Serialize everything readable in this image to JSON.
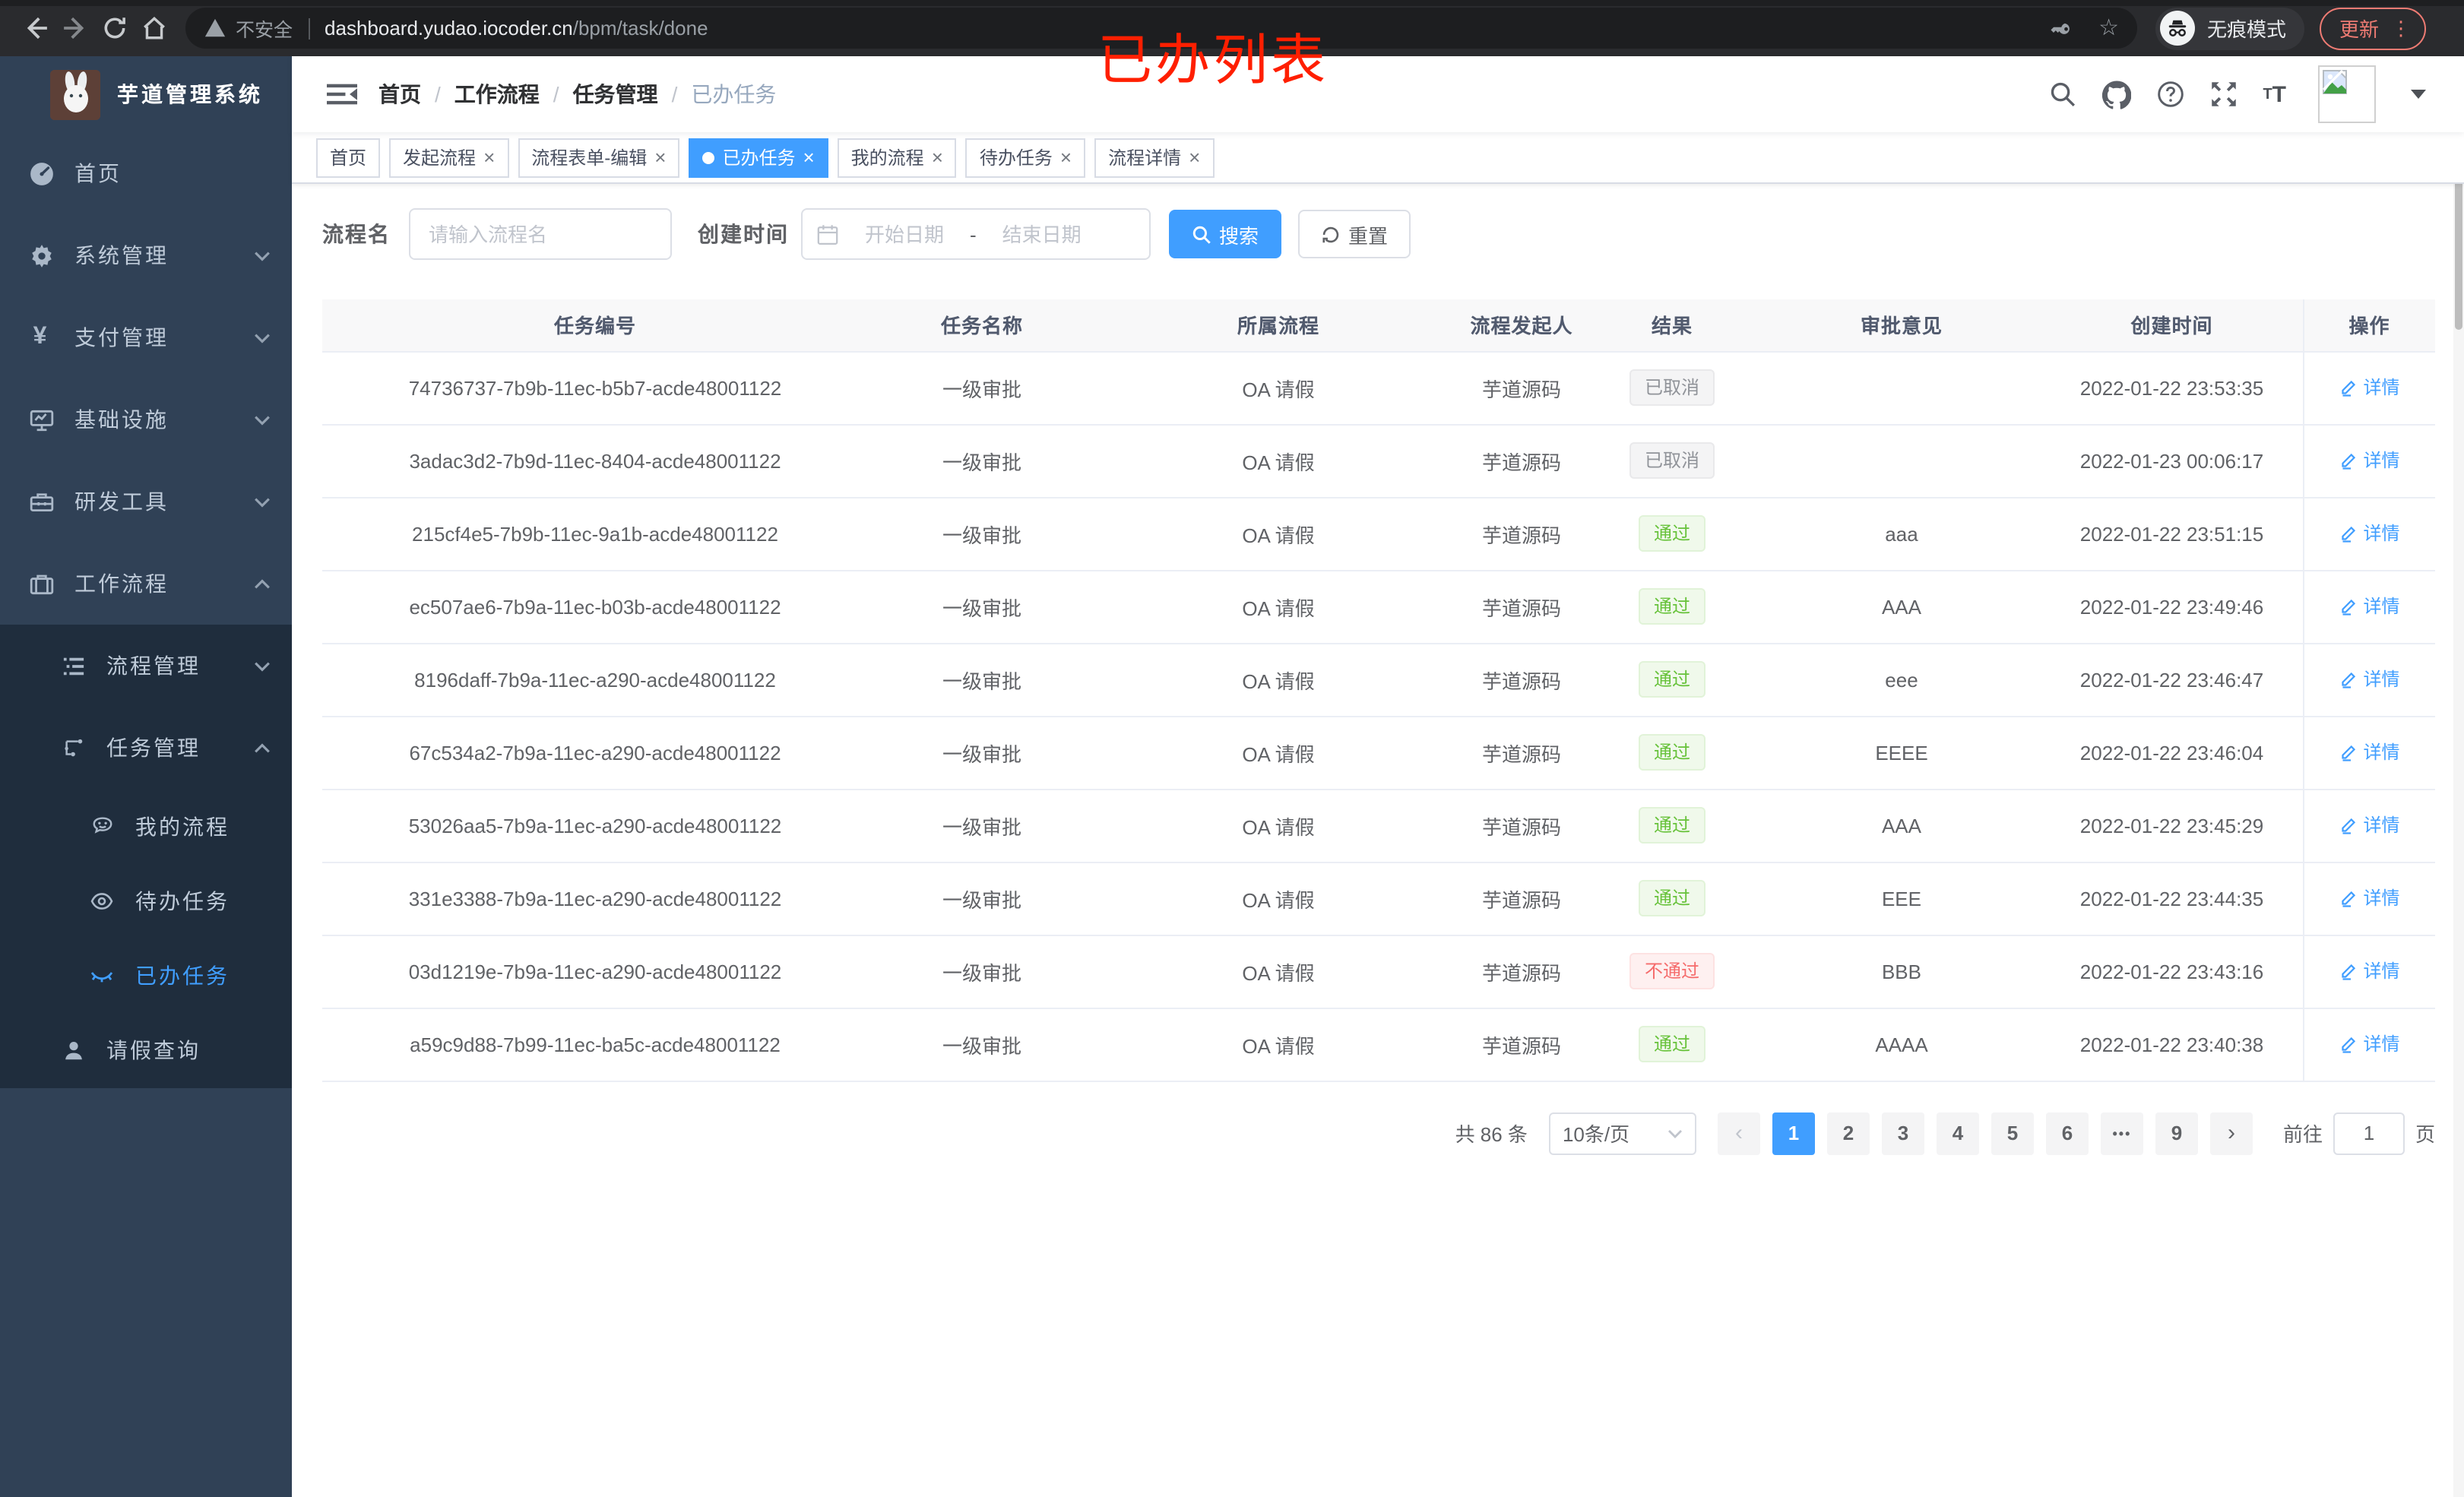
{
  "annotation": {
    "text": "已办列表",
    "color": "#ff1f00"
  },
  "browser": {
    "security_label": "不安全",
    "url_host": "dashboard.yudao.iocoder.cn",
    "url_path": "/bpm/task/done",
    "incognito_label": "无痕模式",
    "update_label": "更新"
  },
  "sidebar": {
    "app_title": "芋道管理系统",
    "menu": [
      {
        "label": "首页"
      },
      {
        "label": "系统管理"
      },
      {
        "label": "支付管理"
      },
      {
        "label": "基础设施"
      },
      {
        "label": "研发工具"
      },
      {
        "label": "工作流程"
      }
    ],
    "submenu": {
      "process_mgmt": "流程管理",
      "task_mgmt": "任务管理",
      "my_process": "我的流程",
      "todo_tasks": "待办任务",
      "done_tasks": "已办任务",
      "leave_query": "请假查询"
    }
  },
  "breadcrumb": [
    "首页",
    "工作流程",
    "任务管理",
    "已办任务"
  ],
  "tabs": [
    {
      "label": "首页"
    },
    {
      "label": "发起流程"
    },
    {
      "label": "流程表单-编辑"
    },
    {
      "label": "已办任务"
    },
    {
      "label": "我的流程"
    },
    {
      "label": "待办任务"
    },
    {
      "label": "流程详情"
    }
  ],
  "filters": {
    "process_name_label": "流程名",
    "process_name_placeholder": "请输入流程名",
    "create_time_label": "创建时间",
    "start_placeholder": "开始日期",
    "range_separator": "-",
    "end_placeholder": "结束日期",
    "search_label": "搜索",
    "reset_label": "重置"
  },
  "table": {
    "columns": [
      "任务编号",
      "任务名称",
      "所属流程",
      "流程发起人",
      "结果",
      "审批意见",
      "创建时间",
      "操作"
    ],
    "detail_label": "详情",
    "rows": [
      {
        "id": "74736737-7b9b-11ec-b5b7-acde48001122",
        "name": "一级审批",
        "process": "OA 请假",
        "starter": "芋道源码",
        "result": "已取消",
        "result_type": "info",
        "opinion": "",
        "time": "2022-01-22 23:53:35"
      },
      {
        "id": "3adac3d2-7b9d-11ec-8404-acde48001122",
        "name": "一级审批",
        "process": "OA 请假",
        "starter": "芋道源码",
        "result": "已取消",
        "result_type": "info",
        "opinion": "",
        "time": "2022-01-23 00:06:17"
      },
      {
        "id": "215cf4e5-7b9b-11ec-9a1b-acde48001122",
        "name": "一级审批",
        "process": "OA 请假",
        "starter": "芋道源码",
        "result": "通过",
        "result_type": "success",
        "opinion": "aaa",
        "time": "2022-01-22 23:51:15"
      },
      {
        "id": "ec507ae6-7b9a-11ec-b03b-acde48001122",
        "name": "一级审批",
        "process": "OA 请假",
        "starter": "芋道源码",
        "result": "通过",
        "result_type": "success",
        "opinion": "AAA",
        "time": "2022-01-22 23:49:46"
      },
      {
        "id": "8196daff-7b9a-11ec-a290-acde48001122",
        "name": "一级审批",
        "process": "OA 请假",
        "starter": "芋道源码",
        "result": "通过",
        "result_type": "success",
        "opinion": "eee",
        "time": "2022-01-22 23:46:47"
      },
      {
        "id": "67c534a2-7b9a-11ec-a290-acde48001122",
        "name": "一级审批",
        "process": "OA 请假",
        "starter": "芋道源码",
        "result": "通过",
        "result_type": "success",
        "opinion": "EEEE",
        "time": "2022-01-22 23:46:04"
      },
      {
        "id": "53026aa5-7b9a-11ec-a290-acde48001122",
        "name": "一级审批",
        "process": "OA 请假",
        "starter": "芋道源码",
        "result": "通过",
        "result_type": "success",
        "opinion": "AAA",
        "time": "2022-01-22 23:45:29"
      },
      {
        "id": "331e3388-7b9a-11ec-a290-acde48001122",
        "name": "一级审批",
        "process": "OA 请假",
        "starter": "芋道源码",
        "result": "通过",
        "result_type": "success",
        "opinion": "EEE",
        "time": "2022-01-22 23:44:35"
      },
      {
        "id": "03d1219e-7b9a-11ec-a290-acde48001122",
        "name": "一级审批",
        "process": "OA 请假",
        "starter": "芋道源码",
        "result": "不通过",
        "result_type": "danger",
        "opinion": "BBB",
        "time": "2022-01-22 23:43:16"
      },
      {
        "id": "a59c9d88-7b99-11ec-ba5c-acde48001122",
        "name": "一级审批",
        "process": "OA 请假",
        "starter": "芋道源码",
        "result": "通过",
        "result_type": "success",
        "opinion": "AAAA",
        "time": "2022-01-22 23:40:38"
      }
    ]
  },
  "pagination": {
    "total": "共 86 条",
    "page_size": "10条/页",
    "pages": [
      "1",
      "2",
      "3",
      "4",
      "5",
      "6",
      "•••",
      "9"
    ],
    "goto_label": "前往",
    "goto_value": "1",
    "goto_suffix": "页"
  },
  "colors": {
    "accent": "#409eff",
    "success": "#67c23a",
    "danger": "#f56c6c",
    "info": "#909399",
    "sidebar": "#304156",
    "submenu": "#1f2d3d"
  }
}
